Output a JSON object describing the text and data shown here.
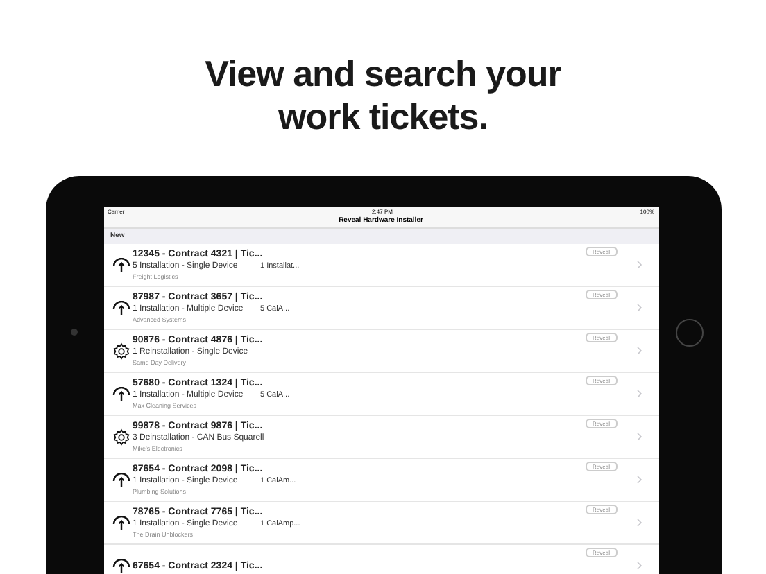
{
  "headline": [
    "View and search your",
    "work tickets."
  ],
  "status_bar": {
    "carrier": "Carrier",
    "time": "2:47 PM",
    "battery": "100%"
  },
  "nav_title": "Reveal Hardware Installer",
  "section_header": "New",
  "tickets": [
    {
      "kind": "antenna",
      "title": "12345 - Contract 4321 | Tic...",
      "subtitle": "5 Installation - Single Device",
      "extra": "1 Installat...",
      "company": "Freight Logistics",
      "badge": "Reveal"
    },
    {
      "kind": "antenna",
      "title": "87987 - Contract 3657 | Tic...",
      "subtitle": "1 Installation - Multiple Device",
      "extra": "5 CalA...",
      "company": "Advanced Systems",
      "badge": "Reveal"
    },
    {
      "kind": "gear",
      "title": "90876 - Contract 4876 | Tic...",
      "subtitle": "1 Reinstallation - Single Device",
      "company": "Same Day Delivery",
      "badge": "Reveal"
    },
    {
      "kind": "antenna",
      "title": "57680 - Contract 1324 | Tic...",
      "subtitle": "1 Installation - Multiple Device",
      "extra": "5 CalA...",
      "company": "Max Cleaning Services",
      "badge": "Reveal"
    },
    {
      "kind": "gear",
      "title": "99878 - Contract 9876 | Tic...",
      "subtitle": "3 Deinstallation - CAN Bus Squarell",
      "company": "Mike's Electronics",
      "badge": "Reveal"
    },
    {
      "kind": "antenna",
      "title": "87654 - Contract 2098 | Tic...",
      "subtitle": "1 Installation - Single Device",
      "extra": "1 CalAm...",
      "company": "Plumbing Solutions",
      "badge": "Reveal"
    },
    {
      "kind": "antenna",
      "title": "78765 - Contract 7765 | Tic...",
      "subtitle": "1 Installation - Single Device",
      "extra": "1 CalAmp...",
      "company": "The Drain Unblockers",
      "badge": "Reveal"
    },
    {
      "kind": "antenna",
      "title": "67654 - Contract 2324 | Tic...",
      "badge": "Reveal"
    }
  ]
}
